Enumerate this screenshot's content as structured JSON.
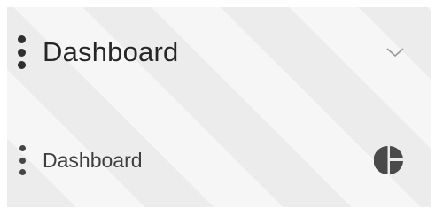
{
  "header": {
    "title": "Dashboard",
    "handle_icon": "drag-handle-icon",
    "toggle_icon": "chevron-down-icon"
  },
  "menu_item": {
    "label": "Dashboard",
    "handle_icon": "drag-handle-icon",
    "icon": "pie-chart-icon"
  },
  "colors": {
    "panel_bg": "#ececec",
    "text_primary": "#262626",
    "text_secondary": "#3f3f3f",
    "icon": "#4a4a4a",
    "chevron": "#9a9a9a"
  }
}
